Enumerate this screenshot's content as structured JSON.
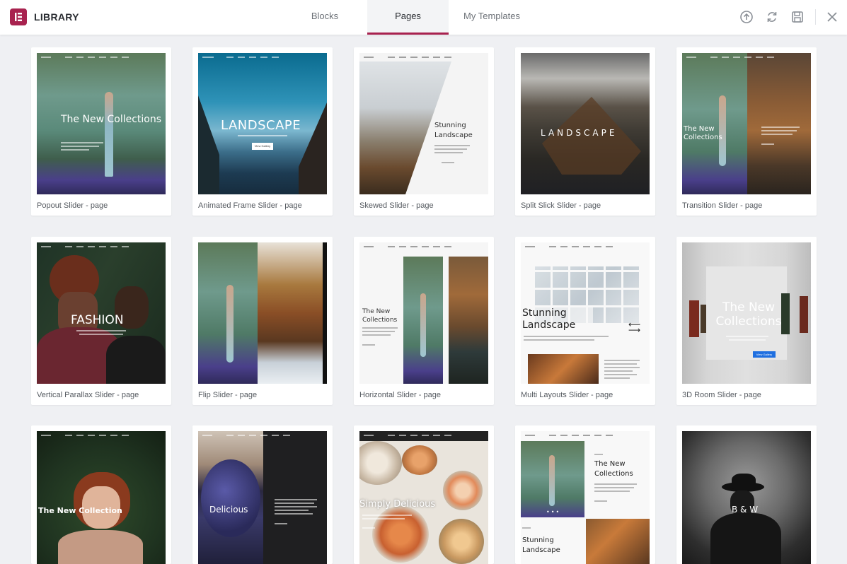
{
  "header": {
    "title": "LIBRARY",
    "tabs": [
      {
        "label": "Blocks",
        "active": false
      },
      {
        "label": "Pages",
        "active": true
      },
      {
        "label": "My Templates",
        "active": false
      }
    ],
    "icons": [
      "upload-icon",
      "sync-icon",
      "save-icon",
      "close-icon"
    ],
    "accent": "#a8224f"
  },
  "templates": [
    {
      "name": "Popout Slider - page",
      "thumb_text": "The New Collections"
    },
    {
      "name": "Animated Frame Slider - page",
      "thumb_text": "LANDSCAPE",
      "thumb_button": "View Gallery"
    },
    {
      "name": "Skewed Slider - page",
      "thumb_text": "Stunning Landscape"
    },
    {
      "name": "Split Slick Slider - page",
      "thumb_text": "LANDSCAPE"
    },
    {
      "name": "Transition Slider - page",
      "thumb_text": "The New Collections"
    },
    {
      "name": "Vertical Parallax Slider - page",
      "thumb_text": "FASHION"
    },
    {
      "name": "Flip Slider - page",
      "thumb_text": ""
    },
    {
      "name": "Horizontal Slider - page",
      "thumb_text": "The New Collections"
    },
    {
      "name": "Multi Layouts Slider - page",
      "thumb_text": "Stunning Landscape"
    },
    {
      "name": "3D Room Slider - page",
      "thumb_text": "The New Collections",
      "thumb_button": "View Gallery"
    },
    {
      "name": "",
      "thumb_text": "The New Collection"
    },
    {
      "name": "",
      "thumb_text": "Delicious"
    },
    {
      "name": "",
      "thumb_text": "Simply Delicious"
    },
    {
      "name": "",
      "thumb_text": "The New Collections",
      "thumb_text_2": "Stunning Landscape"
    },
    {
      "name": "",
      "thumb_text": "B & W"
    }
  ]
}
